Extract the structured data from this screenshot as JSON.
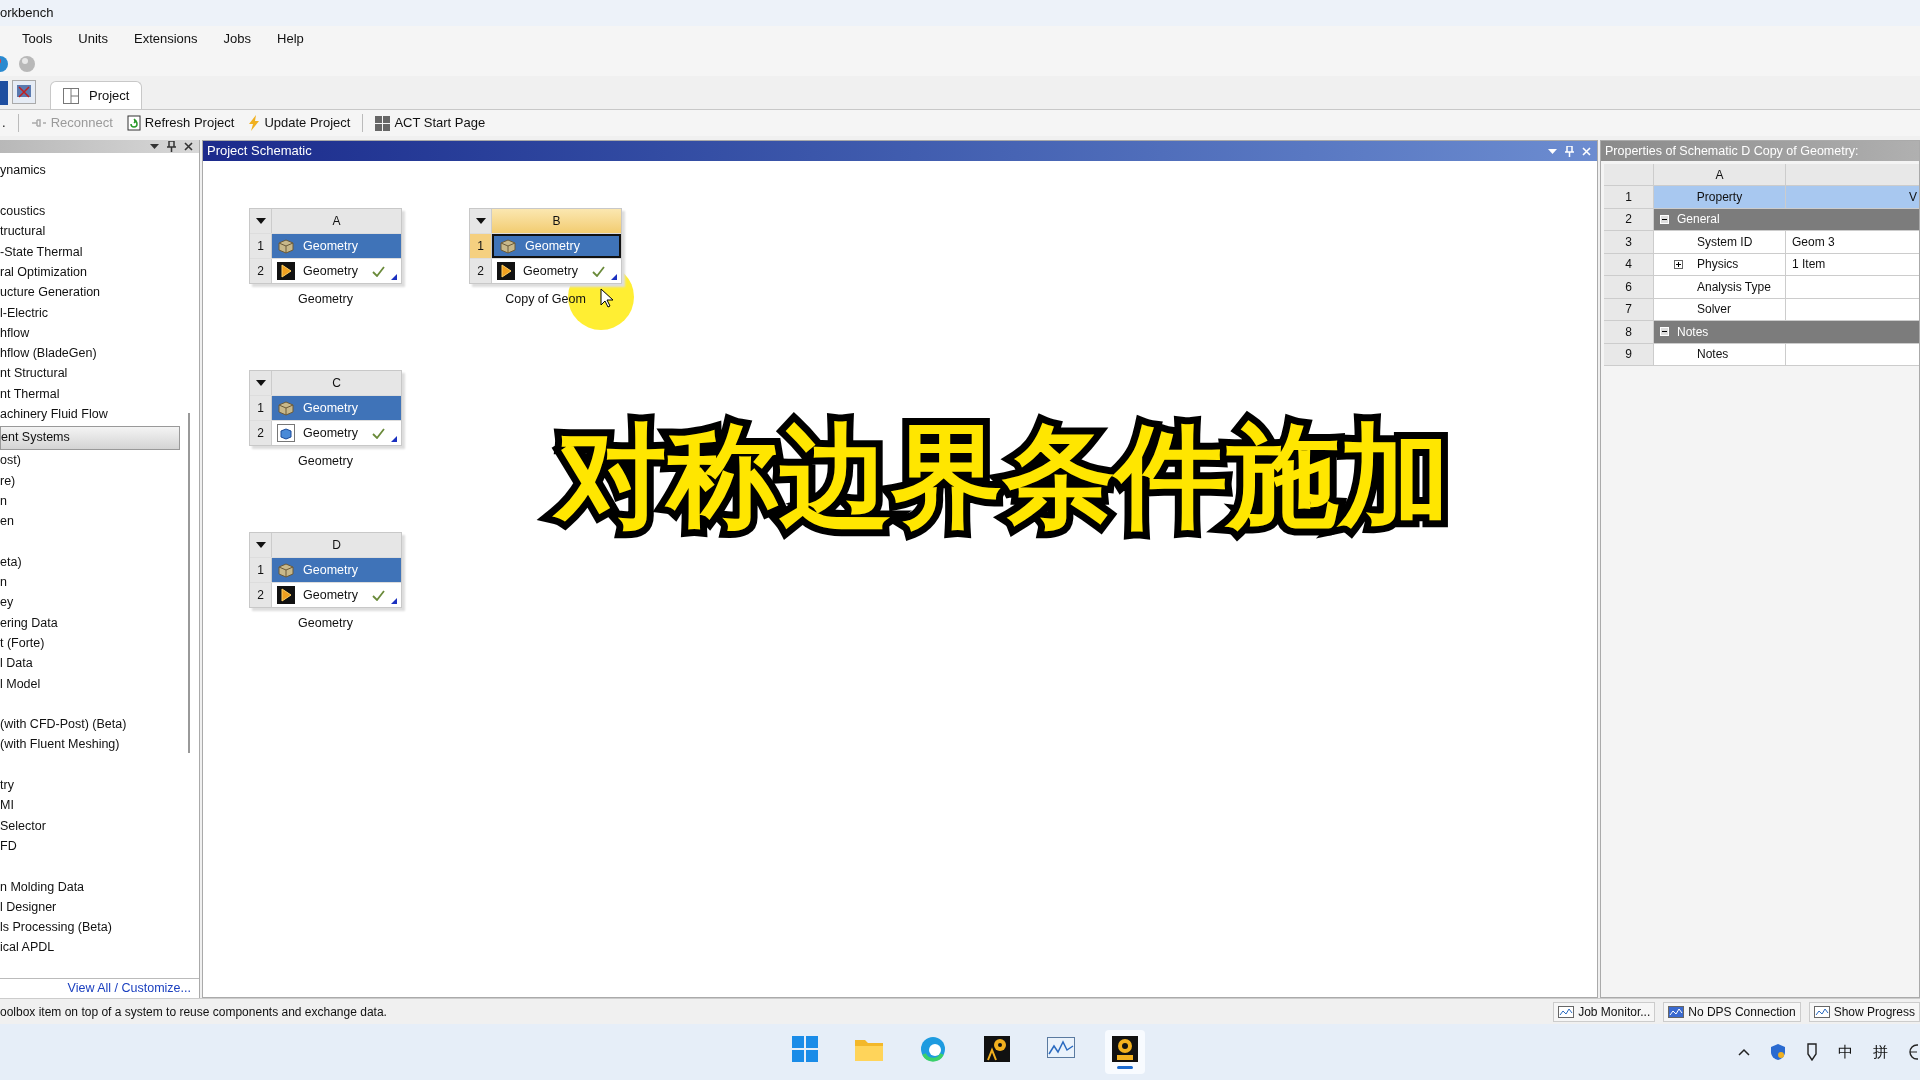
{
  "window": {
    "title": "orkbench"
  },
  "menu": [
    "Tools",
    "Units",
    "Extensions",
    "Jobs",
    "Help"
  ],
  "tabs": [
    {
      "label": "Project",
      "selected": true
    }
  ],
  "toolbar": [
    {
      "label": ".",
      "kind": "text",
      "disabled": false
    },
    {
      "label": "Reconnect",
      "kind": "reconnect",
      "disabled": true
    },
    {
      "label": "Refresh Project",
      "kind": "refresh",
      "disabled": false
    },
    {
      "label": "Update Project",
      "kind": "update",
      "disabled": false
    },
    {
      "label": "ACT Start Page",
      "kind": "grid",
      "disabled": false
    }
  ],
  "toolbox": {
    "sections": [
      [
        {
          "label": "ynamics",
          "kind": "item"
        }
      ],
      [
        {
          "label": "coustics",
          "kind": "item"
        },
        {
          "label": "tructural",
          "kind": "item"
        },
        {
          "label": "-State Thermal",
          "kind": "item"
        },
        {
          "label": "ral Optimization",
          "kind": "item"
        },
        {
          "label": "ucture Generation",
          "kind": "item"
        },
        {
          "label": "l-Electric",
          "kind": "item"
        },
        {
          "label": "hflow",
          "kind": "item"
        },
        {
          "label": "hflow (BladeGen)",
          "kind": "item"
        },
        {
          "label": "nt Structural",
          "kind": "item"
        },
        {
          "label": "nt Thermal",
          "kind": "item"
        },
        {
          "label": "achinery Fluid Flow",
          "kind": "item"
        },
        {
          "label": "ent Systems",
          "kind": "category"
        },
        {
          "label": "ost)",
          "kind": "item"
        },
        {
          "label": "re)",
          "kind": "item"
        },
        {
          "label": "n",
          "kind": "item"
        },
        {
          "label": "en",
          "kind": "item"
        }
      ],
      [
        {
          "label": "eta)",
          "kind": "item"
        },
        {
          "label": "n",
          "kind": "item"
        },
        {
          "label": "ey",
          "kind": "item"
        },
        {
          "label": "ering Data",
          "kind": "item"
        },
        {
          "label": "t (Forte)",
          "kind": "item"
        },
        {
          "label": "l Data",
          "kind": "item"
        },
        {
          "label": "l Model",
          "kind": "item"
        }
      ],
      [
        {
          "label": "(with CFD-Post) (Beta)",
          "kind": "item"
        },
        {
          "label": "(with Fluent Meshing)",
          "kind": "item"
        }
      ],
      [
        {
          "label": "try",
          "kind": "item"
        },
        {
          "label": "MI",
          "kind": "item"
        },
        {
          "label": "Selector",
          "kind": "item"
        },
        {
          "label": "FD",
          "kind": "item"
        }
      ],
      [
        {
          "label": "n Molding Data",
          "kind": "item"
        },
        {
          "label": "l Designer",
          "kind": "item"
        },
        {
          "label": "ls Processing (Beta)",
          "kind": "item"
        },
        {
          "label": "ical APDL",
          "kind": "item"
        }
      ]
    ],
    "link": "View All / Customize..."
  },
  "schematic": {
    "title": "Project Schematic",
    "systems": [
      {
        "letter": "A",
        "caption": "Geometry",
        "selected": false,
        "rows": [
          {
            "num": "1",
            "label": "Geometry",
            "kind": "cube",
            "up_to_date": false
          },
          {
            "num": "2",
            "label": "Geometry",
            "kind": "play",
            "up_to_date": true
          }
        ]
      },
      {
        "letter": "B",
        "caption": "Copy of Geom",
        "selected": true,
        "rows": [
          {
            "num": "1",
            "label": "Geometry",
            "kind": "cube",
            "up_to_date": false
          },
          {
            "num": "2",
            "label": "Geometry",
            "kind": "play",
            "up_to_date": true
          }
        ]
      },
      {
        "letter": "C",
        "caption": "Geometry",
        "selected": false,
        "rows": [
          {
            "num": "1",
            "label": "Geometry",
            "kind": "cube",
            "up_to_date": false
          },
          {
            "num": "2",
            "label": "Geometry",
            "kind": "box",
            "up_to_date": true
          }
        ]
      },
      {
        "letter": "D",
        "caption": "Geometry",
        "selected": false,
        "rows": [
          {
            "num": "1",
            "label": "Geometry",
            "kind": "cube",
            "up_to_date": false
          },
          {
            "num": "2",
            "label": "Geometry",
            "kind": "play",
            "up_to_date": true
          }
        ]
      }
    ],
    "caption": "对称边界条件施加"
  },
  "properties": {
    "title": "Properties of Schematic D Copy of Geometry:",
    "columns": [
      "A"
    ],
    "rows": [
      {
        "num": "1",
        "kind": "heading",
        "name": "Property",
        "value": "V"
      },
      {
        "num": "2",
        "kind": "group",
        "name": "General",
        "expanded": true
      },
      {
        "num": "3",
        "kind": "property",
        "name": "System ID",
        "value": "Geom 3"
      },
      {
        "num": "4",
        "kind": "property",
        "name": "Physics",
        "value": "1 Item",
        "expanded": false
      },
      {
        "num": "6",
        "kind": "property",
        "name": "Analysis Type"
      },
      {
        "num": "7",
        "kind": "property",
        "name": "Solver"
      },
      {
        "num": "8",
        "kind": "group",
        "name": "Notes",
        "expanded": true
      },
      {
        "num": "9",
        "kind": "property",
        "name": "Notes"
      }
    ]
  },
  "status_bar": {
    "message": "oolbox item on top of a system to reuse components and exchange data.",
    "buttons": [
      "Job Monitor...",
      "No DPS Connection",
      "Show Progress"
    ]
  },
  "taskbar": {
    "apps": [
      {
        "kind": "windows",
        "selected": false
      },
      {
        "kind": "folder",
        "selected": false
      },
      {
        "kind": "browser",
        "selected": false
      },
      {
        "kind": "ansys",
        "selected": false
      },
      {
        "kind": "chart",
        "selected": false
      },
      {
        "kind": "workbench",
        "selected": true
      }
    ],
    "tray": [
      "中",
      "拼"
    ]
  }
}
